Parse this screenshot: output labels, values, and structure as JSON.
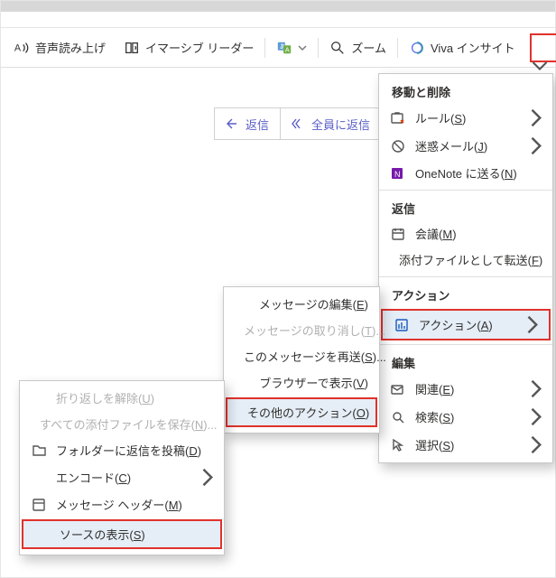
{
  "toolbar": {
    "read_aloud": "音声読み上げ",
    "immersive_reader": "イマーシブ リーダー",
    "translate": "",
    "zoom": "ズーム",
    "viva_insights": "Viva インサイト"
  },
  "replybar": {
    "reply": "返信",
    "reply_all": "全員に返信"
  },
  "menu_main": {
    "section_move_delete": "移動と削除",
    "rules": {
      "label": "ルール(",
      "accel": "S",
      "suffix": ")"
    },
    "junk": {
      "label": "迷惑メール(",
      "accel": "J",
      "suffix": ")"
    },
    "onenote": {
      "label": "OneNote に送る(",
      "accel": "N",
      "suffix": ")"
    },
    "section_reply": "返信",
    "meeting": {
      "label": "会議(",
      "accel": "M",
      "suffix": ")"
    },
    "forward_attachment": {
      "label": "添付ファイルとして転送(",
      "accel": "F",
      "suffix": ")"
    },
    "section_actions": "アクション",
    "actions": {
      "label": "アクション(",
      "accel": "A",
      "suffix": ")"
    },
    "section_edit": "編集",
    "related": {
      "label": "関連(",
      "accel": "E",
      "suffix": ")"
    },
    "search": {
      "label": "検索(",
      "accel": "S",
      "suffix": ")"
    },
    "select": {
      "label": "選択(",
      "accel": "S",
      "suffix": ")"
    }
  },
  "menu_actions_sub": {
    "edit_message": {
      "label": "メッセージの編集(",
      "accel": "E",
      "suffix": ")"
    },
    "recall_message": {
      "label": "メッセージの取り消し(",
      "accel": "T",
      "suffix": ")..."
    },
    "resend_message": {
      "label": "このメッセージを再送(",
      "accel": "S",
      "suffix": ")..."
    },
    "view_browser": {
      "label": "ブラウザーで表示(",
      "accel": "V",
      "suffix": ")"
    },
    "other_actions": {
      "label": "その他のアクション(",
      "accel": "O",
      "suffix": ")"
    }
  },
  "menu_other_sub": {
    "unflag": {
      "label": "折り返しを解除(",
      "accel": "U",
      "suffix": ")"
    },
    "save_all_attachments": {
      "label": "すべての添付ファイルを保存(",
      "accel": "N",
      "suffix": ")..."
    },
    "post_reply_folder": {
      "label": "フォルダーに返信を投稿(",
      "accel": "D",
      "suffix": ")"
    },
    "encode": {
      "label": "エンコード(",
      "accel": "C",
      "suffix": ")"
    },
    "message_header": {
      "label": "メッセージ ヘッダー(",
      "accel": "M",
      "suffix": ")"
    },
    "view_source": {
      "label": "ソースの表示(",
      "accel": "S",
      "suffix": ")"
    }
  }
}
